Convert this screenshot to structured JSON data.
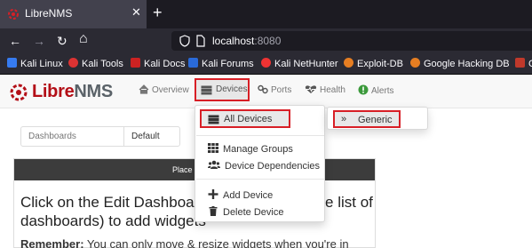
{
  "browser": {
    "tab_title": "LibreNMS",
    "tab_close": "✕",
    "new_tab": "+",
    "back": "←",
    "forward": "→",
    "reload": "↻",
    "home": "⌂",
    "url_host": "localhost",
    "url_port": ":8080",
    "bookmarks": [
      {
        "label": "Kali Linux",
        "color": "#367bf0"
      },
      {
        "label": "Kali Tools",
        "color": "#d33"
      },
      {
        "label": "Kali Docs",
        "color": "#c22"
      },
      {
        "label": "Kali Forums",
        "color": "#2a6ad8"
      },
      {
        "label": "Kali NetHunter",
        "color": "#e33"
      },
      {
        "label": "Exploit-DB",
        "color": "#e67e22"
      },
      {
        "label": "Google Hacking DB",
        "color": "#e67e22"
      },
      {
        "label": "O",
        "color": "#c0392b"
      }
    ]
  },
  "app": {
    "logo_libre": "Libre",
    "logo_nms": "NMS",
    "brand_color": "#b30f17",
    "nav": {
      "overview": "Overview",
      "devices": "Devices",
      "ports": "Ports",
      "health": "Health",
      "alerts": "Alerts"
    },
    "dashboard": {
      "label": "Dashboards",
      "value": "Default"
    },
    "panel": {
      "header": "Place",
      "title": "Click on the Edit Dashboard button (next to the list of dashboards) to add widgets",
      "note_bold": "Remember:",
      "note_text": " You can only move & resize widgets when you're in"
    },
    "devices_menu": {
      "all_devices": "All Devices",
      "manage_groups": "Manage Groups",
      "device_dependencies": "Device Dependencies",
      "add_device": "Add Device",
      "delete_device": "Delete Device"
    },
    "submenu": {
      "generic": "Generic"
    },
    "highlight_color": "#d81f26"
  }
}
